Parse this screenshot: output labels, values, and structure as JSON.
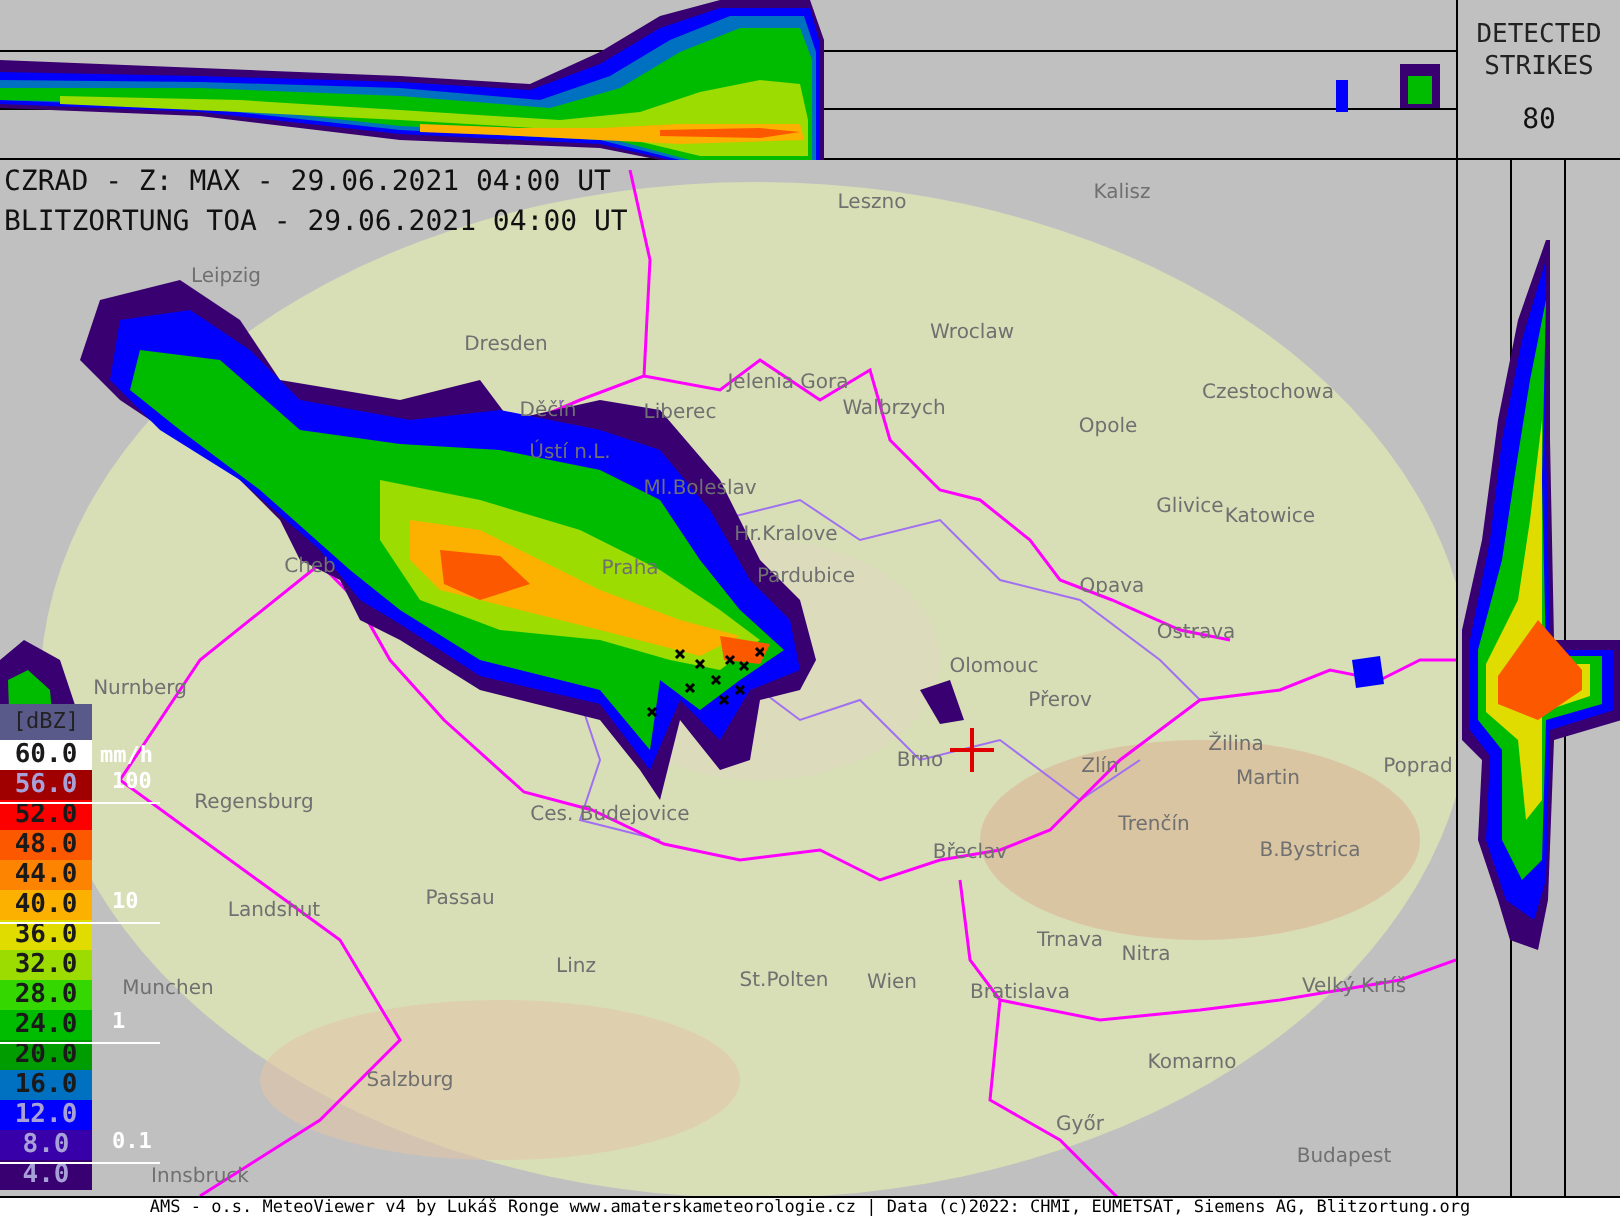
{
  "strikes_panel": {
    "title": "DETECTED STRIKES",
    "count": "80"
  },
  "header": [
    "CZRAD - Z: MAX - 29.06.2021 04:00 UT",
    "BLITZORTUNG TOA - 29.06.2021 04:00 UT"
  ],
  "legend": {
    "unit": "[dBZ]",
    "rate_unit": "mm/h",
    "rate_marks": [
      "100",
      "10",
      "1",
      "0.1"
    ],
    "scale": [
      {
        "label": "60.0",
        "color": "#ffffff"
      },
      {
        "label": "56.0",
        "color": "#a00000"
      },
      {
        "label": "52.0",
        "color": "#fc0000"
      },
      {
        "label": "48.0",
        "color": "#fc5800"
      },
      {
        "label": "44.0",
        "color": "#fc8400"
      },
      {
        "label": "40.0",
        "color": "#fcb000"
      },
      {
        "label": "36.0",
        "color": "#e0dc00"
      },
      {
        "label": "32.0",
        "color": "#9cdc00"
      },
      {
        "label": "28.0",
        "color": "#34d800"
      },
      {
        "label": "24.0",
        "color": "#00bc00"
      },
      {
        "label": "20.0",
        "color": "#009c00"
      },
      {
        "label": "16.0",
        "color": "#0070c0"
      },
      {
        "label": "12.0",
        "color": "#0000fc"
      },
      {
        "label": "8.0",
        "color": "#3800a8"
      },
      {
        "label": "4.0",
        "color": "#380070"
      }
    ]
  },
  "cities": [
    "Leszno",
    "Kalisz",
    "Leipzig",
    "Dresden",
    "Wroclaw",
    "Jelenia Gora",
    "Czestochowa",
    "Děčín",
    "Liberec",
    "Walbrzych",
    "Opole",
    "Ústí n.L.",
    "Ml.Boleslav",
    "Glivice",
    "Katowice",
    "Hr.Kralove",
    "Cheb",
    "Praha",
    "Pardubice",
    "Opava",
    "Ostrava",
    "Olomouc",
    "Nurnberg",
    "Přerov",
    "Brno",
    "Zlín",
    "Žilina",
    "Martin",
    "Poprad",
    "Regensburg",
    "Ces. Budejovice",
    "Trenčín",
    "Břeclav",
    "B.Bystrica",
    "Landshut",
    "Passau",
    "Trnava",
    "Nitra",
    "Munchen",
    "Linz",
    "St.Polten",
    "Wien",
    "Bratislava",
    "Velký Krtíš",
    "Komarno",
    "Salzburg",
    "Győr",
    "Budapest",
    "Innsbruck"
  ],
  "footer": "AMS - o.s. MeteoViewer v4 by Lukáš Ronge www.amaterskameteorologie.cz | Data (c)2022: CHMI, EUMETSAT, Siemens AG, Blitzortung.org"
}
